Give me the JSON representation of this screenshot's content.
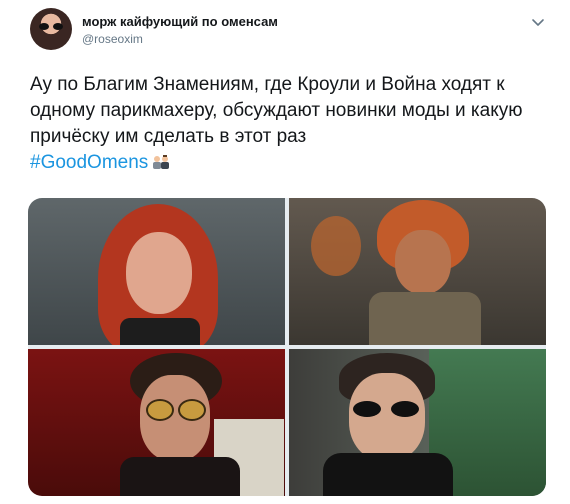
{
  "author": {
    "display_name": "морж кайфующий по оменсам",
    "handle": "@roseoxim"
  },
  "tweet": {
    "text": "Ау по Благим Знамениям, где Кроули и Война ходят к одному парикмахеру, обсуждают новинки моды и какую причёску им сделать в этот раз",
    "hashtag": "#GoodOmens"
  },
  "icons": {
    "menu": "chevron-down-icon",
    "emoji": "haircut-emoji-icon"
  },
  "colors": {
    "link": "#1b95e0",
    "secondary_text": "#657786"
  }
}
